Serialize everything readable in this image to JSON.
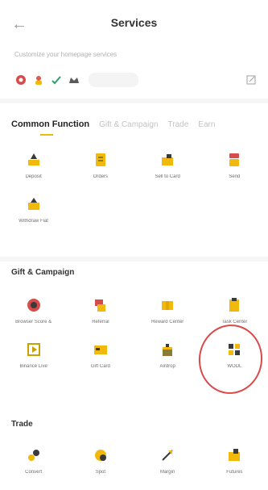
{
  "header": {
    "title": "Services",
    "subtitle": "Customize your homepage services"
  },
  "pinned": {
    "icons": [
      "red-badge-icon",
      "red-person-icon",
      "check-chart-icon",
      "crown-icon"
    ]
  },
  "tabs": [
    "Common Function",
    "Gift & Campaign",
    "Trade",
    "Earn"
  ],
  "common": [
    {
      "label": "Deposit",
      "icon": "deposit-icon"
    },
    {
      "label": "Orders",
      "icon": "orders-icon"
    },
    {
      "label": "Sell to Card",
      "icon": "sell-card-icon"
    },
    {
      "label": "Send",
      "icon": "send-icon"
    },
    {
      "label": "Withdraw Fiat",
      "icon": "withdraw-icon"
    }
  ],
  "gift_section_title": "Gift & Campaign",
  "gift": [
    {
      "label": "Browser Score &",
      "icon": "score-icon"
    },
    {
      "label": "Referral",
      "icon": "referral-icon"
    },
    {
      "label": "Reward Center",
      "icon": "reward-icon"
    },
    {
      "label": "Task Center",
      "icon": "task-icon"
    },
    {
      "label": "Binance Live",
      "icon": "live-icon"
    },
    {
      "label": "Gift Card",
      "icon": "gift-card-icon"
    },
    {
      "label": "Airdrop",
      "icon": "airdrop-icon"
    },
    {
      "label": "WODL",
      "icon": "wodl-icon"
    }
  ],
  "trade_section_title": "Trade",
  "trade": [
    {
      "label": "Convert",
      "icon": "convert-icon"
    },
    {
      "label": "Spot",
      "icon": "spot-icon"
    },
    {
      "label": "Margin",
      "icon": "margin-icon"
    },
    {
      "label": "Futures",
      "icon": "futures-icon"
    }
  ],
  "colors": {
    "accent": "#f0b90b",
    "annotation": "#d94b4b"
  }
}
